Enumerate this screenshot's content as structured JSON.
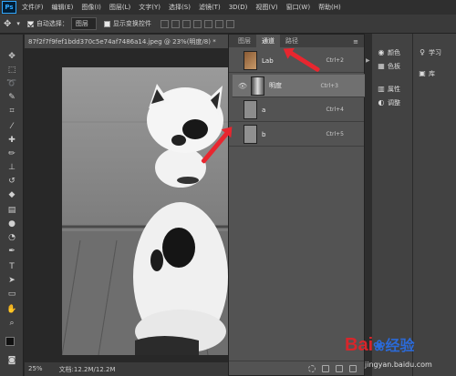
{
  "app": {
    "logo": "Ps"
  },
  "menu": [
    "文件(F)",
    "编辑(E)",
    "图像(I)",
    "图层(L)",
    "文字(Y)",
    "选择(S)",
    "滤镜(T)",
    "3D(D)",
    "视图(V)",
    "窗口(W)",
    "帮助(H)"
  ],
  "options": {
    "auto_select_label": "自动选择：",
    "auto_select_value": "图层",
    "show_transform_label": "显示变换控件"
  },
  "document": {
    "tab_title": "87f2f7f9fef1bdd370c5e74af7486a14.jpeg @ 23%(明度/8) *",
    "zoom": "25%",
    "doc_size": "文档:12.2M/12.2M"
  },
  "channels_panel": {
    "tabs": [
      "图层",
      "通道",
      "路径"
    ],
    "active_tab": "通道",
    "rows": [
      {
        "name": "Lab",
        "shortcut": "Ctrl+2",
        "visible": false,
        "selected": false
      },
      {
        "name": "明度",
        "shortcut": "Ctrl+3",
        "visible": true,
        "selected": true
      },
      {
        "name": "a",
        "shortcut": "Ctrl+4",
        "visible": false,
        "selected": false
      },
      {
        "name": "b",
        "shortcut": "Ctrl+5",
        "visible": false,
        "selected": false
      }
    ]
  },
  "side_panels": {
    "mid": [
      {
        "label": "颜色",
        "icon": "palette-icon"
      },
      {
        "label": "色板",
        "icon": "swatches-icon"
      },
      {
        "label": "属性",
        "icon": "properties-icon"
      },
      {
        "label": "调整",
        "icon": "adjustments-icon"
      }
    ],
    "right": [
      {
        "label": "学习",
        "icon": "lightbulb-icon"
      },
      {
        "label": "库",
        "icon": "library-icon"
      }
    ]
  },
  "watermark": {
    "brand_a": "Bai",
    "brand_b": "经验",
    "url": "jingyan.baidu.com"
  },
  "colors": {
    "arrow": "#e8262f",
    "panel": "#535353",
    "selected_row": "#707070",
    "watermark_red": "#d7262b",
    "watermark_blue": "#2b6ad8"
  }
}
